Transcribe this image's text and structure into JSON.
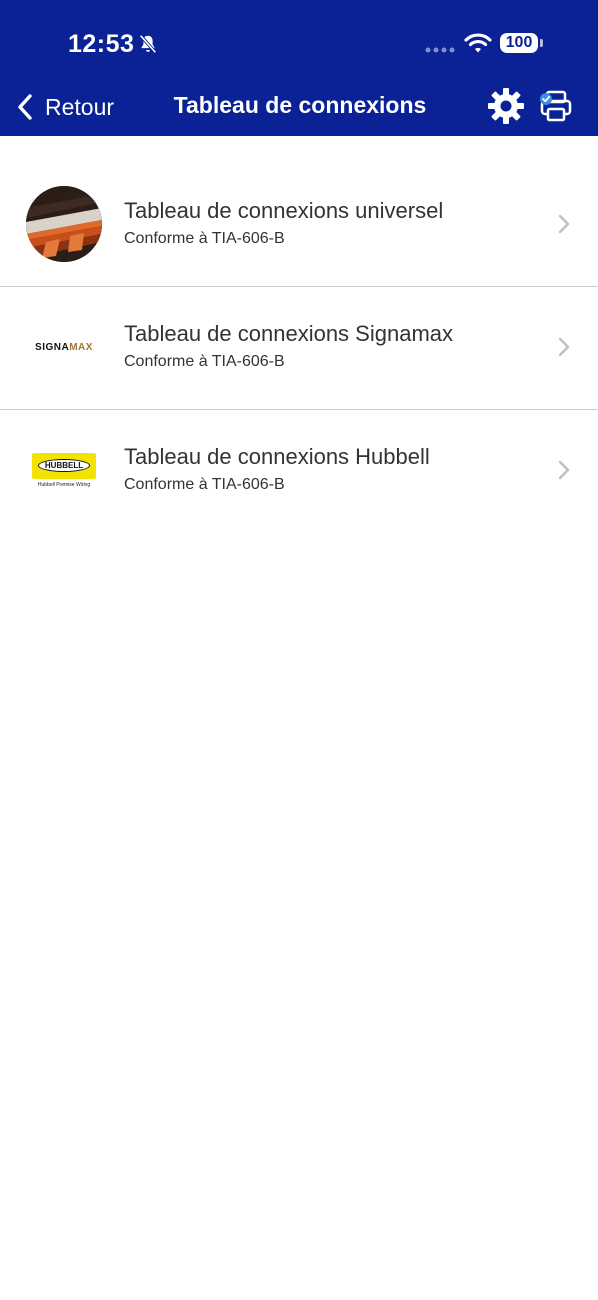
{
  "status_bar": {
    "time": "12:53",
    "battery": "100"
  },
  "nav": {
    "back_label": "Retour",
    "title": "Tableau de connexions"
  },
  "items": [
    {
      "title": "Tableau de connexions universel",
      "subtitle": "Conforme à TIA-606-B",
      "logo": "patch-panel-photo"
    },
    {
      "title": "Tableau de connexions Signamax",
      "subtitle": "Conforme à TIA-606-B",
      "logo": "signamax-logo",
      "logo_text_a": "SIGNA",
      "logo_text_b": "MAX"
    },
    {
      "title": "Tableau de connexions Hubbell",
      "subtitle": "Conforme à TIA-606-B",
      "logo": "hubbell-logo",
      "logo_text": "HUBBELL",
      "logo_tagline": "Hubbell Premise Wiring"
    }
  ],
  "colors": {
    "header_bg": "#0a2296",
    "text": "#333333",
    "divider": "#c8c8c8",
    "chevron": "#c0c0c0"
  }
}
